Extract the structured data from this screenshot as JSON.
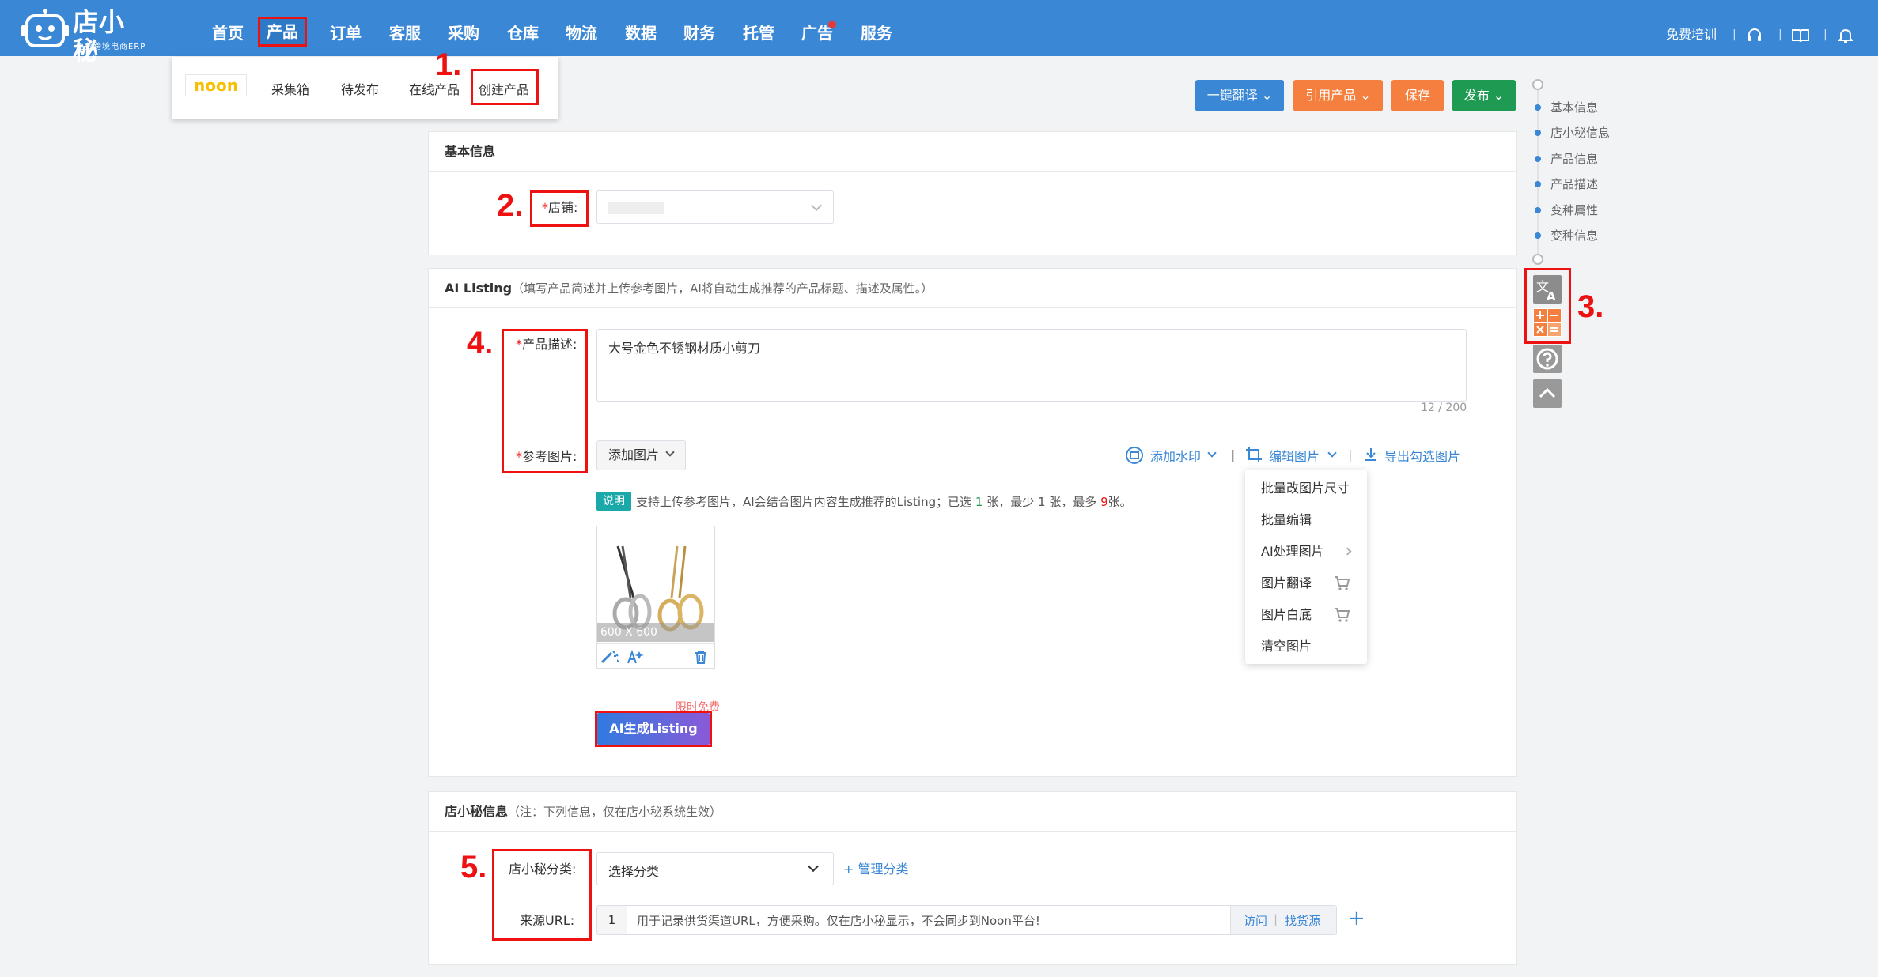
{
  "brand": {
    "name": "店小秘",
    "subtitle": "免费跨境电商ERP"
  },
  "nav": {
    "items": [
      "首页",
      "产品",
      "订单",
      "客服",
      "采购",
      "仓库",
      "物流",
      "数据",
      "财务",
      "托管",
      "广告",
      "服务"
    ],
    "active": "产品",
    "right": {
      "training": "免费培训"
    }
  },
  "submenu": {
    "logo_text": "noon",
    "items": [
      "采集箱",
      "待发布",
      "在线产品",
      "创建产品"
    ],
    "active": "创建产品"
  },
  "annotations": [
    "1.",
    "2.",
    "3.",
    "4.",
    "5."
  ],
  "toolbar": {
    "translate": "一键翻译",
    "reference": "引用产品",
    "save": "保存",
    "publish": "发布",
    "colors": {
      "translate": "#3a87d5",
      "reference": "#f47f3e",
      "save": "#f47f3e",
      "publish": "#1e9a52"
    }
  },
  "basic_info": {
    "title": "基本信息",
    "store_label": "店铺",
    "store_value": ""
  },
  "ai_listing": {
    "title": "AI Listing",
    "hint": "（填写产品简述并上传参考图片，AI将自动生成推荐的产品标题、描述及属性。）",
    "desc_label": "产品描述",
    "desc_value": "大号金色不锈钢材质小剪刀",
    "desc_count": "12 / 200",
    "ref_label": "参考图片",
    "add_image": "添加图片",
    "watermark": "添加水印",
    "edit_image": "编辑图片",
    "export": "导出勾选图片",
    "note_badge": "说明",
    "note_prefix": "支持上传参考图片，AI会结合图片内容生成推荐的Listing；已选 ",
    "selected": "1",
    "note_mid1": " 张，最少 ",
    "min": "1",
    "note_mid2": " 张，最多 ",
    "max": "9",
    "note_suffix": "张。",
    "image_size": "600 X 600",
    "free_tag": "限时免费",
    "generate": "AI生成Listing",
    "edit_menu": [
      "批量改图片尺寸",
      "批量编辑",
      "AI处理图片",
      "图片翻译",
      "图片白底",
      "清空图片"
    ]
  },
  "dxm_info": {
    "title": "店小秘信息",
    "hint": "（注：下列信息，仅在店小秘系统生效）",
    "category_label": "店小秘分类",
    "category_placeholder": "选择分类",
    "manage": "+ 管理分类",
    "url_label": "来源URL",
    "url_index": "1",
    "url_placeholder": "用于记录供货渠道URL，方便采购。仅在店小秘显示，不会同步到Noon平台!",
    "visit": "访问",
    "find_source": "找货源"
  },
  "side_nav": [
    "基本信息",
    "店小秘信息",
    "产品信息",
    "产品描述",
    "变种属性",
    "变种信息"
  ],
  "side_tools": [
    "translate-icon",
    "calculator-icon",
    "help-icon",
    "back-to-top-icon"
  ]
}
